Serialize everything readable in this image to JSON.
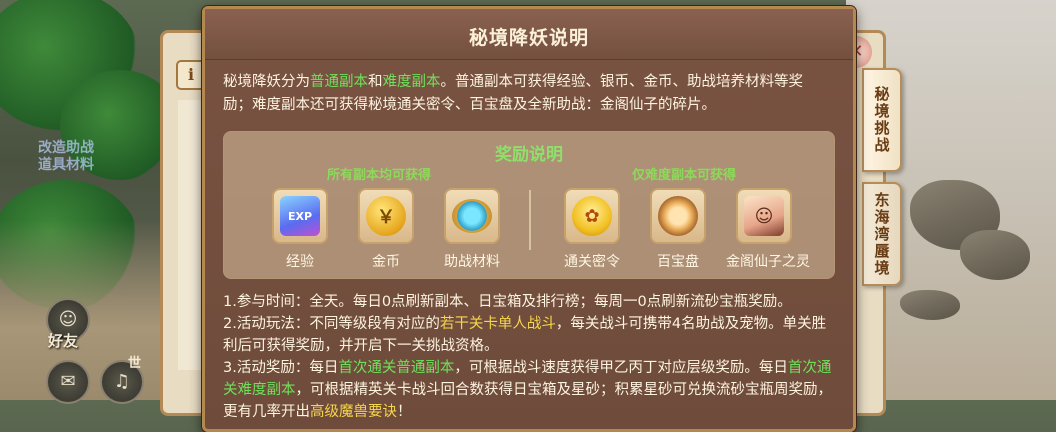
{
  "popup": {
    "title": "秘境降妖说明"
  },
  "intro": {
    "t1": "秘境降妖分为",
    "h1": "普通副本",
    "t2": "和",
    "h2": "难度副本",
    "t3": "。普通副本可获得经验、银币、金币、助战培养材料等奖励；难度副本还可获得秘境通关密令、百宝盘及全新助战：金阁仙子的碎片。"
  },
  "rewards": {
    "title": "奖励说明",
    "group_all": "所有副本均可获得",
    "group_hard": "仅难度副本可获得",
    "items": [
      {
        "label": "经验",
        "icon": "exp-icon",
        "glyph": "EXP 经验"
      },
      {
        "label": "金币",
        "icon": "gold-coin-icon",
        "glyph": "￥"
      },
      {
        "label": "助战材料",
        "icon": "support-material-icon",
        "glyph": ""
      },
      {
        "label": "通关密令",
        "icon": "clear-token-icon",
        "glyph": "✿"
      },
      {
        "label": "百宝盘",
        "icon": "treasure-plate-icon",
        "glyph": ""
      },
      {
        "label": "金阁仙子之灵",
        "icon": "golden-fairy-spirit-icon",
        "glyph": "☺"
      }
    ]
  },
  "rules": {
    "r1": "1.参与时间：全天。每日0点刷新副本、日宝箱及排行榜；每周一0点刷新流砂宝瓶奖励。",
    "r2a": "2.活动玩法：不同等级段有对应的",
    "r2h": "若干关卡单人战斗",
    "r2b": "，每关战斗可携带4名助战及宠物。单关胜利后可获得奖励，并开启下一关挑战资格。",
    "r3a": "3.活动奖励：每日",
    "r3h1": "首次通关普通副本",
    "r3b": "，可根据战斗速度获得甲乙丙丁对应层级奖励。每日",
    "r3h2": "首次通关难度副本",
    "r3c": "，可根据精英关卡战斗回合数获得日宝箱及星砂；积累星砂可兑换流砂宝瓶周奖励，更有几率开出",
    "r3h3": "高级魔兽要诀",
    "r3d": "！"
  },
  "side_tabs": {
    "tab1": "秘境挑战",
    "tab2": "东海湾蜃境"
  },
  "background": {
    "ghost_text": "改造助战\n道具材料",
    "friend": "好友",
    "world": "世"
  },
  "colors": {
    "popup_bg": "#74503f",
    "highlight_green": "#6fe05a",
    "highlight_yellow": "#f5d64c",
    "text": "#fdf4e0"
  }
}
